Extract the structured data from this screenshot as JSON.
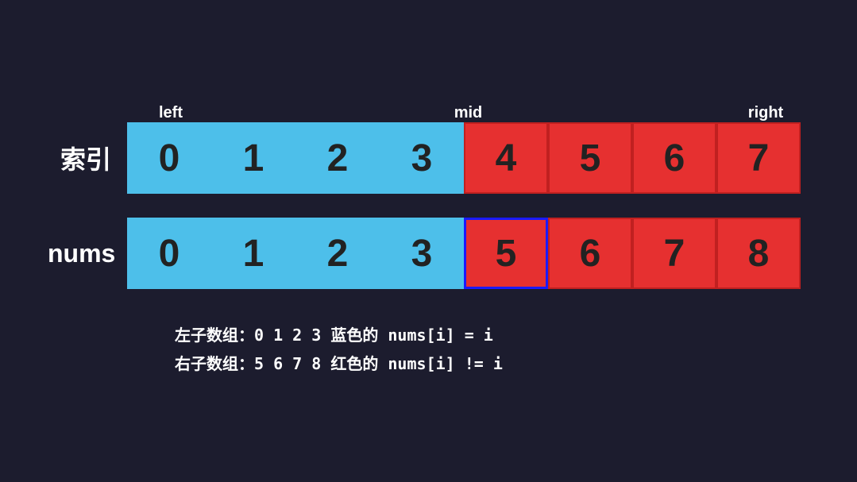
{
  "labels": {
    "left": "left",
    "mid": "mid",
    "right": "right"
  },
  "index_row": {
    "label": "索引",
    "cells": [
      {
        "value": "0",
        "color": "blue"
      },
      {
        "value": "1",
        "color": "blue"
      },
      {
        "value": "2",
        "color": "blue"
      },
      {
        "value": "3",
        "color": "blue"
      },
      {
        "value": "4",
        "color": "red"
      },
      {
        "value": "5",
        "color": "red"
      },
      {
        "value": "6",
        "color": "red"
      },
      {
        "value": "7",
        "color": "red"
      }
    ]
  },
  "nums_row": {
    "label": "nums",
    "cells": [
      {
        "value": "0",
        "color": "blue"
      },
      {
        "value": "1",
        "color": "blue"
      },
      {
        "value": "2",
        "color": "blue"
      },
      {
        "value": "3",
        "color": "blue"
      },
      {
        "value": "5",
        "color": "red-highlight"
      },
      {
        "value": "6",
        "color": "red"
      },
      {
        "value": "7",
        "color": "red"
      },
      {
        "value": "8",
        "color": "red"
      }
    ]
  },
  "description": {
    "line1": "左子数组：0 1 2 3  蓝色的 nums[i]  = i",
    "line2": "右子数组：5 6 7 8  红色的 nums[i] != i"
  }
}
